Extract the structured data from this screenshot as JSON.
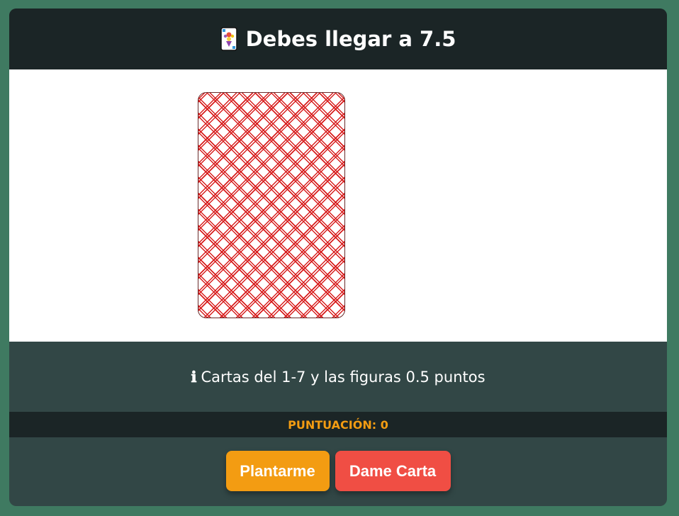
{
  "header": {
    "icon": "joker-card-icon",
    "title": "Debes llegar a 7.5"
  },
  "board": {
    "card": "card-back"
  },
  "info": {
    "icon": "ℹ",
    "text": "Cartas del 1-7 y las figuras 0.5 puntos"
  },
  "score": {
    "label": "PUNTUACIÓN: 0"
  },
  "controls": {
    "stand_label": "Plantarme",
    "hit_label": "Dame Carta"
  },
  "colors": {
    "background": "#3f7a61",
    "header": "#1b2526",
    "panel": "#324746",
    "score_text": "#f39c12",
    "stand_button": "#f39c12",
    "hit_button": "#f04e44",
    "card_pattern": "#d81e1e"
  }
}
